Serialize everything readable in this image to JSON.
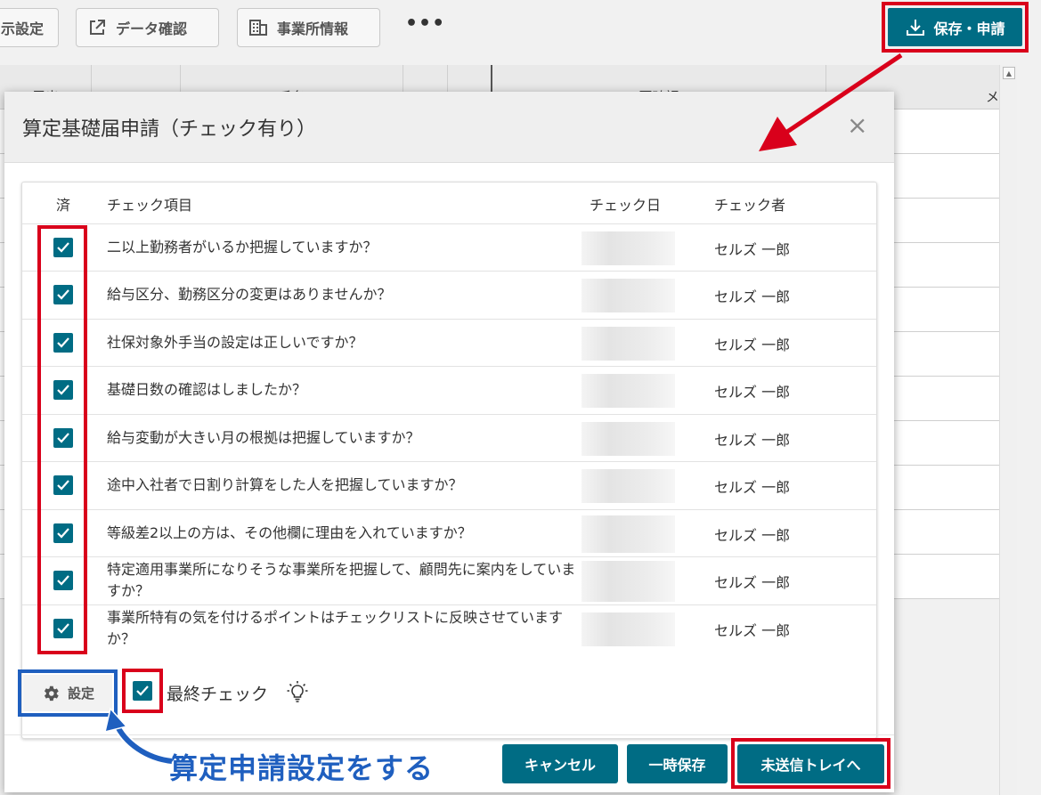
{
  "toolbar": {
    "display_settings_label": "示設定",
    "data_check_label": "データ確認",
    "office_info_label": "事業所情報",
    "more_label": "•••",
    "save_apply_label": "保存・申請"
  },
  "background_table": {
    "headers": [
      "届出",
      "No",
      "氏名",
      "",
      "",
      "要確認",
      "メ"
    ]
  },
  "dialog": {
    "title": "算定基礎届申請（チェック有り）",
    "close_label": "×",
    "columns": {
      "done": "済",
      "item": "チェック項目",
      "date": "チェック日",
      "checker": "チェック者"
    },
    "items": [
      {
        "text": "二以上勤務者がいるか把握していますか？",
        "checker": "セルズ 一郎",
        "checked": true
      },
      {
        "text": "給与区分、勤務区分の変更はありませんか？",
        "checker": "セルズ 一郎",
        "checked": true
      },
      {
        "text": "社保対象外手当の設定は正しいですか？",
        "checker": "セルズ 一郎",
        "checked": true
      },
      {
        "text": "基礎日数の確認はしましたか？",
        "checker": "セルズ 一郎",
        "checked": true
      },
      {
        "text": "給与変動が大きい月の根拠は把握していますか？",
        "checker": "セルズ 一郎",
        "checked": true
      },
      {
        "text": "途中入社者で日割り計算をした人を把握していますか？",
        "checker": "セルズ 一郎",
        "checked": true
      },
      {
        "text": "等級差2以上の方は、その他欄に理由を入れていますか？",
        "checker": "セルズ 一郎",
        "checked": true
      },
      {
        "text": "特定適用事業所になりそうな事業所を把握して、顧問先に案内をしていますか？",
        "checker": "セルズ 一郎",
        "checked": true
      },
      {
        "text": "事業所特有の気を付けるポイントはチェックリストに反映させていますか？",
        "checker": "セルズ 一郎",
        "checked": true
      }
    ],
    "settings_label": "設定",
    "final_check_label": "最終チェック",
    "cancel_label": "キャンセル",
    "temp_save_label": "一時保存",
    "send_tray_label": "未送信トレイへ"
  },
  "annotation": {
    "text": "算定申請設定をする"
  },
  "colors": {
    "accent": "#006c84",
    "highlight_red": "#d9001b",
    "highlight_blue": "#1f5fbf"
  }
}
